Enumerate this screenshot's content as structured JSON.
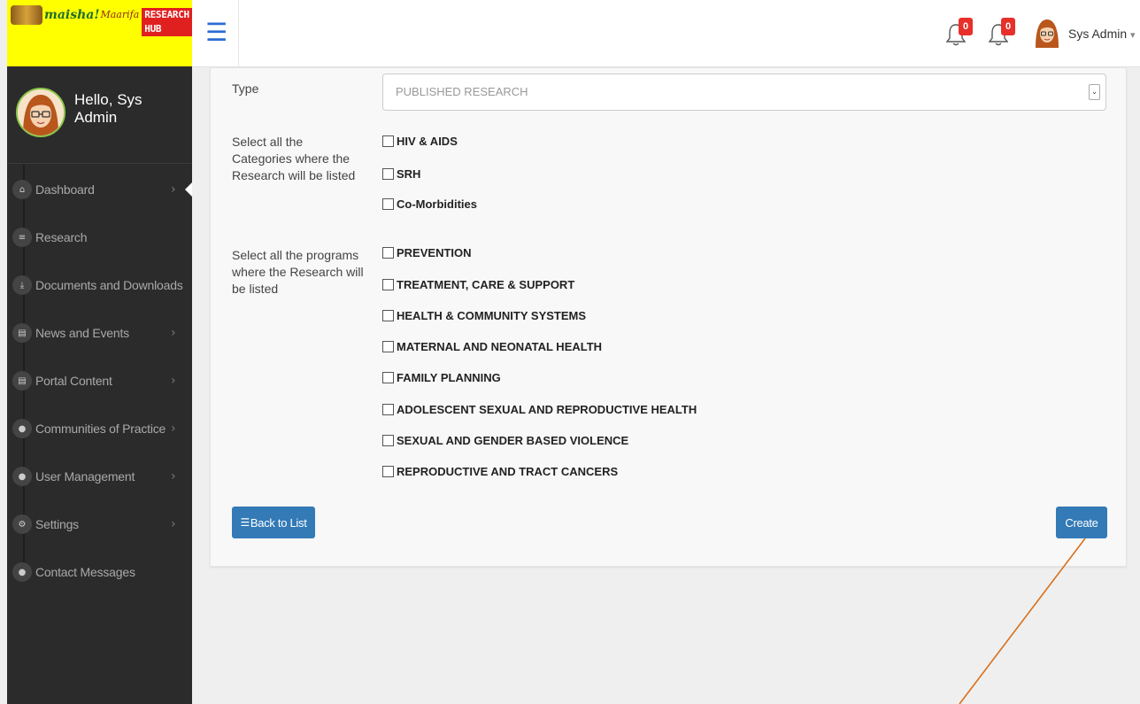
{
  "brand": {
    "name_part1": "mai",
    "name_part1b": "sha!",
    "name_part2": "Maarifa",
    "badge": "RESEARCH HUB"
  },
  "profile": {
    "greeting": "Hello,",
    "first_name": "Sys",
    "last_name": "Admin"
  },
  "sidebar": {
    "items": [
      {
        "label": "Dashboard",
        "icon": "home-icon",
        "has_chevron": true,
        "active": true
      },
      {
        "label": "Research",
        "icon": "file-icon",
        "has_chevron": false
      },
      {
        "label": "Documents and Downloads",
        "icon": "download-icon",
        "has_chevron": false
      },
      {
        "label": "News and Events",
        "icon": "newspaper-icon",
        "has_chevron": true
      },
      {
        "label": "Portal Content",
        "icon": "newspaper-icon",
        "has_chevron": true
      },
      {
        "label": "Communities of Practice",
        "icon": "users-icon",
        "has_chevron": true
      },
      {
        "label": "User Management",
        "icon": "users-icon",
        "has_chevron": true
      },
      {
        "label": "Settings",
        "icon": "cogs-icon",
        "has_chevron": true
      },
      {
        "label": "Contact Messages",
        "icon": "users-icon",
        "has_chevron": false
      }
    ]
  },
  "header": {
    "notifications": [
      {
        "count": "0",
        "icon": "bell-icon"
      },
      {
        "count": "0",
        "icon": "bell-icon"
      }
    ],
    "user_name": "Sys Admin",
    "caret": "▾"
  },
  "form": {
    "type_label": "Type",
    "type_value": "PUBLISHED RESEARCH",
    "categories_label": "Select all the Categories where the Research will be listed",
    "categories": [
      "HIV & AIDS",
      "SRH",
      "Co-Morbidities"
    ],
    "programs_label": "Select all the programs where the Research will be listed",
    "programs": [
      "PREVENTION",
      "TREATMENT, CARE & SUPPORT",
      "HEALTH & COMMUNITY SYSTEMS",
      "MATERNAL AND NEONATAL HEALTH",
      "FAMILY PLANNING",
      "ADOLESCENT SEXUAL AND REPRODUCTIVE HEALTH",
      "SEXUAL AND GENDER BASED VIOLENCE",
      "REPRODUCTIVE AND TRACT CANCERS"
    ],
    "back_label": "Back to List",
    "create_label": "Create"
  },
  "colors": {
    "accent": "#337ab7",
    "sidebar_bg": "#2b2b2b",
    "logo_bg": "#ffff00",
    "badge": "#e8302a",
    "annotation_arrow": "#d86f1c"
  }
}
